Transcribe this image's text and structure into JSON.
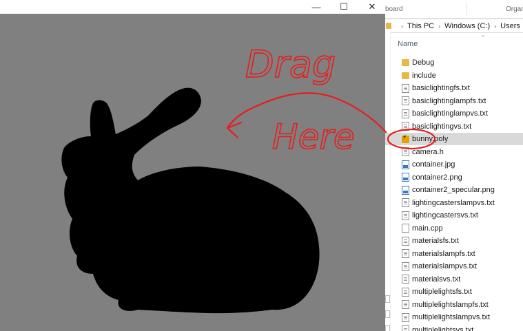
{
  "render_window": {
    "minimize_icon": "—",
    "maximize_icon": "☐",
    "close_icon": "✕",
    "background_color": "#808080",
    "model_color": "#000000"
  },
  "annotation": {
    "line1": "Drag",
    "line2": "Here",
    "color": "#e81c1c"
  },
  "explorer": {
    "ribbon": {
      "clipboard_label": "board",
      "organize_label": "Organ"
    },
    "breadcrumb": [
      "This PC",
      "Windows (C:)",
      "Users"
    ],
    "column_header": "Name",
    "files": [
      {
        "name": "Debug",
        "type": "folder",
        "icon": "folder-icon"
      },
      {
        "name": "include",
        "type": "folder",
        "icon": "folder-icon"
      },
      {
        "name": "basiclightingfs.txt",
        "type": "txt",
        "icon": "text-file-icon"
      },
      {
        "name": "basiclightinglampfs.txt",
        "type": "txt",
        "icon": "text-file-icon"
      },
      {
        "name": "basiclightinglampvs.txt",
        "type": "txt",
        "icon": "text-file-icon"
      },
      {
        "name": "basiclightingvs.txt",
        "type": "txt",
        "icon": "text-file-icon"
      },
      {
        "name": "bunny.poly",
        "type": "poly",
        "icon": "poly-file-icon",
        "selected": true
      },
      {
        "name": "camera.h",
        "type": "txt",
        "icon": "header-file-icon"
      },
      {
        "name": "container.jpg",
        "type": "img",
        "icon": "image-file-icon"
      },
      {
        "name": "container2.png",
        "type": "img",
        "icon": "image-file-icon"
      },
      {
        "name": "container2_specular.png",
        "type": "img",
        "icon": "image-file-icon"
      },
      {
        "name": "lightingcasterslampvs.txt",
        "type": "txt",
        "icon": "text-file-icon"
      },
      {
        "name": "lightingcastersvs.txt",
        "type": "txt",
        "icon": "text-file-icon"
      },
      {
        "name": "main.cpp",
        "type": "cpp",
        "icon": "cpp-file-icon"
      },
      {
        "name": "materialsfs.txt",
        "type": "txt",
        "icon": "text-file-icon"
      },
      {
        "name": "materialslampfs.txt",
        "type": "txt",
        "icon": "text-file-icon"
      },
      {
        "name": "materialslampvs.txt",
        "type": "txt",
        "icon": "text-file-icon"
      },
      {
        "name": "materialsvs.txt",
        "type": "txt",
        "icon": "text-file-icon"
      },
      {
        "name": "multiplelightsfs.txt",
        "type": "txt",
        "icon": "text-file-icon"
      },
      {
        "name": "multiplelightslampfs.txt",
        "type": "txt",
        "icon": "text-file-icon"
      },
      {
        "name": "multiplelightslampvs.txt",
        "type": "txt",
        "icon": "text-file-icon"
      },
      {
        "name": "multiplelightsvs.txt",
        "type": "txt",
        "icon": "text-file-icon"
      }
    ],
    "selection_color": "#d9d9d9"
  }
}
